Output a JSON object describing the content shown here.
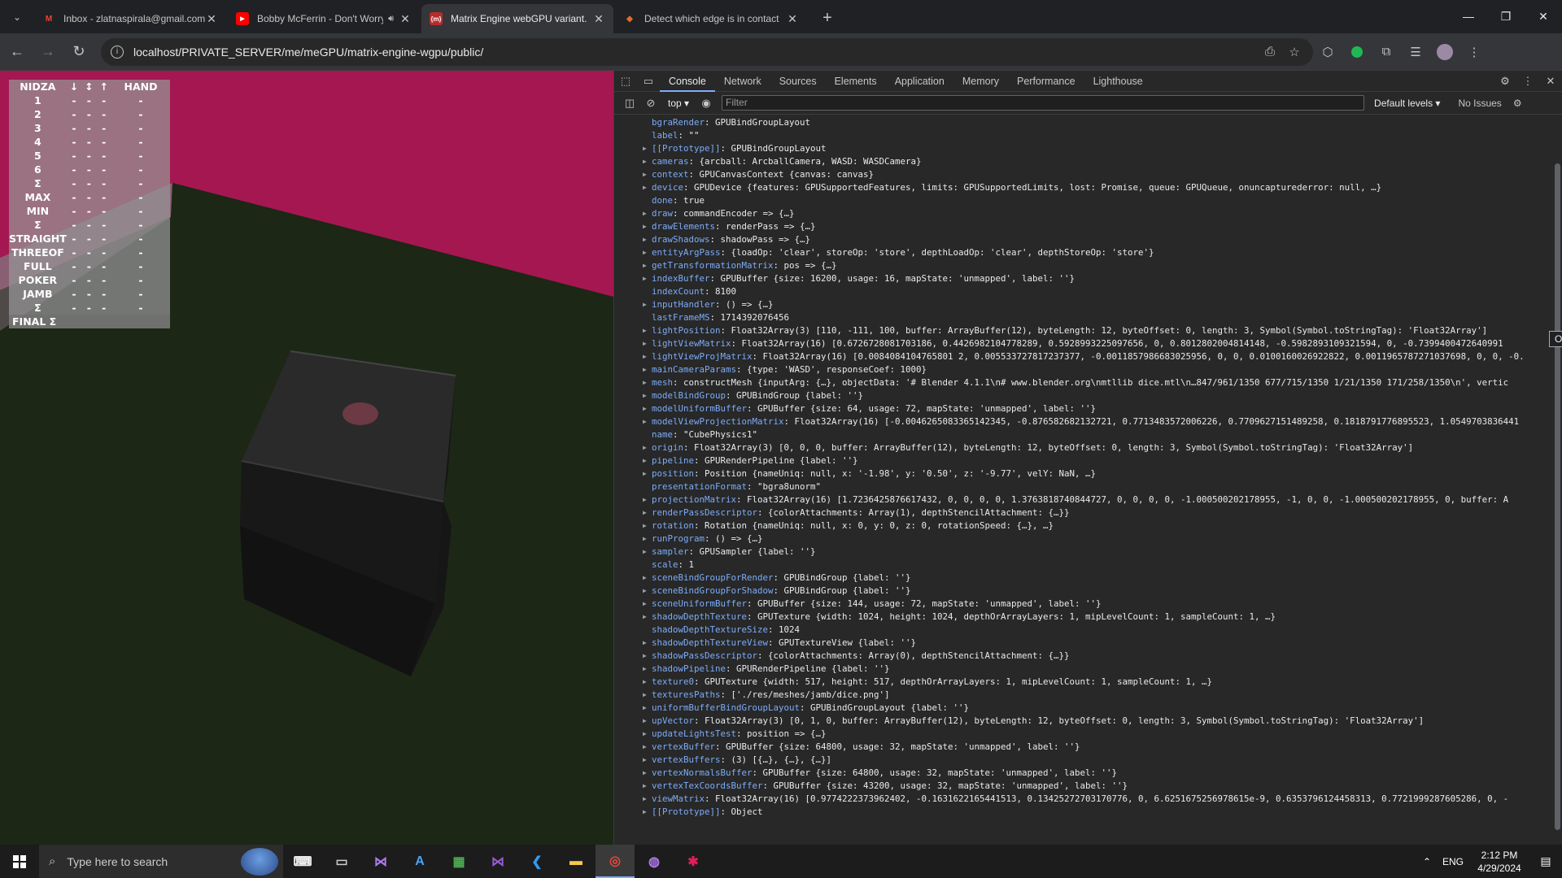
{
  "browser": {
    "tabs": [
      {
        "title": "Inbox - zlatnaspirala@gmail.com",
        "favicon": "gmail-icon",
        "color": "#ea4335",
        "glyph": "M"
      },
      {
        "title": "Bobby McFerrin - Don't Worry",
        "favicon": "youtube-icon",
        "color": "#ff0000",
        "glyph": "▶"
      },
      {
        "title": "Matrix Engine webGPU variant.",
        "favicon": "matrix-engine-icon",
        "color": "#e04040",
        "glyph": "m"
      },
      {
        "title": "Detect which edge is in contact",
        "favicon": "doc-icon",
        "color": "#e26a2c",
        "glyph": "◆"
      }
    ],
    "url": "localhost/PRIVATE_SERVER/me/meGPU/matrix-engine-wgpu/public/"
  },
  "scoreboard": {
    "headers": [
      "NIDZA",
      "↓",
      "↕",
      "↑",
      "HAND"
    ],
    "rows": [
      [
        "1",
        "-",
        "-",
        "-",
        "-"
      ],
      [
        "2",
        "-",
        "-",
        "-",
        "-"
      ],
      [
        "3",
        "-",
        "-",
        "-",
        "-"
      ],
      [
        "4",
        "-",
        "-",
        "-",
        "-"
      ],
      [
        "5",
        "-",
        "-",
        "-",
        "-"
      ],
      [
        "6",
        "-",
        "-",
        "-",
        "-"
      ],
      [
        "Σ",
        "-",
        "-",
        "-",
        "-"
      ],
      [
        "MAX",
        "-",
        "-",
        "-",
        "-"
      ],
      [
        "MIN",
        "-",
        "-",
        "-",
        "-"
      ],
      [
        "Σ",
        "-",
        "-",
        "-",
        "-"
      ],
      [
        "STRAIGHT",
        "-",
        "-",
        "-",
        "-"
      ],
      [
        "THREEOF",
        "-",
        "-",
        "-",
        "-"
      ],
      [
        "FULL",
        "-",
        "-",
        "-",
        "-"
      ],
      [
        "POKER",
        "-",
        "-",
        "-",
        "-"
      ],
      [
        "JAMB",
        "-",
        "-",
        "-",
        "-"
      ],
      [
        "Σ",
        "-",
        "-",
        "-",
        "-"
      ]
    ],
    "final_label": "FINAL Σ"
  },
  "devtools": {
    "tabs": [
      "Console",
      "Network",
      "Sources",
      "Elements",
      "Application",
      "Memory",
      "Performance",
      "Lighthouse"
    ],
    "active_tab": "Console",
    "context": "top ▾",
    "filter_placeholder": "Filter",
    "levels": "Default levels ▾",
    "issues": "No Issues",
    "tooltip": "Object",
    "console_lines": [
      {
        "arrow": false,
        "key": "bgraRender",
        "value": "GPUBindGroupLayout"
      },
      {
        "arrow": false,
        "key": "label",
        "value": "\"\""
      },
      {
        "arrow": true,
        "key": "[[Prototype]]",
        "value": "GPUBindGroupLayout"
      },
      {
        "arrow": true,
        "key": "cameras",
        "value": "{arcball: ArcballCamera, WASD: WASDCamera}"
      },
      {
        "arrow": true,
        "key": "context",
        "value": "GPUCanvasContext {canvas: canvas}"
      },
      {
        "arrow": true,
        "key": "device",
        "value": "GPUDevice {features: GPUSupportedFeatures, limits: GPUSupportedLimits, lost: Promise, queue: GPUQueue, onuncapturederror: null, …}"
      },
      {
        "arrow": false,
        "key": "done",
        "value": "true"
      },
      {
        "arrow": true,
        "key": "draw",
        "value": "commandEncoder => {…}"
      },
      {
        "arrow": true,
        "key": "drawElements",
        "value": "renderPass => {…}"
      },
      {
        "arrow": true,
        "key": "drawShadows",
        "value": "shadowPass => {…}"
      },
      {
        "arrow": true,
        "key": "entityArgPass",
        "value": "{loadOp: 'clear', storeOp: 'store', depthLoadOp: 'clear', depthStoreOp: 'store'}"
      },
      {
        "arrow": true,
        "key": "getTransformationMatrix",
        "value": "pos => {…}"
      },
      {
        "arrow": true,
        "key": "indexBuffer",
        "value": "GPUBuffer {size: 16200, usage: 16, mapState: 'unmapped', label: ''}"
      },
      {
        "arrow": false,
        "key": "indexCount",
        "value": "8100"
      },
      {
        "arrow": true,
        "key": "inputHandler",
        "value": "() => {…}"
      },
      {
        "arrow": false,
        "key": "lastFrameMS",
        "value": "1714392076456"
      },
      {
        "arrow": true,
        "key": "lightPosition",
        "value": "Float32Array(3) [110, -111, 100, buffer: ArrayBuffer(12), byteLength: 12, byteOffset: 0, length: 3, Symbol(Symbol.toStringTag): 'Float32Array']"
      },
      {
        "arrow": true,
        "key": "lightViewMatrix",
        "value": "Float32Array(16) [0.6726728081703186, 0.4426982104778289, 0.5928993225097656, 0, 0.8012802004814148, -0.5982893109321594, 0, -0.7399400472640991"
      },
      {
        "arrow": true,
        "key": "lightViewProjMatrix",
        "value": "Float32Array(16) [0.0084084104765801 2, 0.005533727817237377, -0.0011857986683025956, 0, 0, 0.0100160026922822, 0.0011965787271037698, 0, 0, -0."
      },
      {
        "arrow": true,
        "key": "mainCameraParams",
        "value": "{type: 'WASD', responseCoef: 1000}"
      },
      {
        "arrow": true,
        "key": "mesh",
        "value": "constructMesh {inputArg: {…}, objectData: '# Blender 4.1.1\\n# www.blender.org\\nmtllib dice.mtl\\n…847/961/1350 677/715/1350 1/21/1350 171/258/1350\\n', vertic"
      },
      {
        "arrow": true,
        "key": "modelBindGroup",
        "value": "GPUBindGroup {label: ''}"
      },
      {
        "arrow": true,
        "key": "modelUniformBuffer",
        "value": "GPUBuffer {size: 64, usage: 72, mapState: 'unmapped', label: ''}"
      },
      {
        "arrow": true,
        "key": "modelViewProjectionMatrix",
        "value": "Float32Array(16) [-0.0046265083365142345, -0.876582682132721, 0.7713483572006226, 0.7709627151489258, 0.1818791776895523, 1.0549703836441"
      },
      {
        "arrow": false,
        "key": "name",
        "value": "\"CubePhysics1\""
      },
      {
        "arrow": true,
        "key": "origin",
        "value": "Float32Array(3) [0, 0, 0, buffer: ArrayBuffer(12), byteLength: 12, byteOffset: 0, length: 3, Symbol(Symbol.toStringTag): 'Float32Array']"
      },
      {
        "arrow": true,
        "key": "pipeline",
        "value": "GPURenderPipeline {label: ''}"
      },
      {
        "arrow": true,
        "key": "position",
        "value": "Position {nameUniq: null, x: '-1.98', y: '0.50', z: '-9.77', velY: NaN, …}"
      },
      {
        "arrow": false,
        "key": "presentationFormat",
        "value": "\"bgra8unorm\""
      },
      {
        "arrow": true,
        "key": "projectionMatrix",
        "value": "Float32Array(16) [1.7236425876617432, 0, 0, 0, 0, 1.3763818740844727, 0, 0, 0, 0, -1.000500202178955, -1, 0, 0, -1.000500202178955, 0, buffer: A"
      },
      {
        "arrow": true,
        "key": "renderPassDescriptor",
        "value": "{colorAttachments: Array(1), depthStencilAttachment: {…}}"
      },
      {
        "arrow": true,
        "key": "rotation",
        "value": "Rotation {nameUniq: null, x: 0, y: 0, z: 0, rotationSpeed: {…}, …}"
      },
      {
        "arrow": true,
        "key": "runProgram",
        "value": "() => {…}"
      },
      {
        "arrow": true,
        "key": "sampler",
        "value": "GPUSampler {label: ''}"
      },
      {
        "arrow": false,
        "key": "scale",
        "value": "1"
      },
      {
        "arrow": true,
        "key": "sceneBindGroupForRender",
        "value": "GPUBindGroup {label: ''}"
      },
      {
        "arrow": true,
        "key": "sceneBindGroupForShadow",
        "value": "GPUBindGroup {label: ''}"
      },
      {
        "arrow": true,
        "key": "sceneUniformBuffer",
        "value": "GPUBuffer {size: 144, usage: 72, mapState: 'unmapped', label: ''}"
      },
      {
        "arrow": true,
        "key": "shadowDepthTexture",
        "value": "GPUTexture {width: 1024, height: 1024, depthOrArrayLayers: 1, mipLevelCount: 1, sampleCount: 1, …}"
      },
      {
        "arrow": false,
        "key": "shadowDepthTextureSize",
        "value": "1024"
      },
      {
        "arrow": true,
        "key": "shadowDepthTextureView",
        "value": "GPUTextureView {label: ''}"
      },
      {
        "arrow": true,
        "key": "shadowPassDescriptor",
        "value": "{colorAttachments: Array(0), depthStencilAttachment: {…}}"
      },
      {
        "arrow": true,
        "key": "shadowPipeline",
        "value": "GPURenderPipeline {label: ''}"
      },
      {
        "arrow": true,
        "key": "texture0",
        "value": "GPUTexture {width: 517, height: 517, depthOrArrayLayers: 1, mipLevelCount: 1, sampleCount: 1, …}"
      },
      {
        "arrow": true,
        "key": "texturesPaths",
        "value": "['./res/meshes/jamb/dice.png']"
      },
      {
        "arrow": true,
        "key": "uniformBufferBindGroupLayout",
        "value": "GPUBindGroupLayout {label: ''}"
      },
      {
        "arrow": true,
        "key": "upVector",
        "value": "Float32Array(3) [0, 1, 0, buffer: ArrayBuffer(12), byteLength: 12, byteOffset: 0, length: 3, Symbol(Symbol.toStringTag): 'Float32Array']"
      },
      {
        "arrow": true,
        "key": "updateLightsTest",
        "value": "position => {…}"
      },
      {
        "arrow": true,
        "key": "vertexBuffer",
        "value": "GPUBuffer {size: 64800, usage: 32, mapState: 'unmapped', label: ''}"
      },
      {
        "arrow": true,
        "key": "vertexBuffers",
        "value": "(3) [{…}, {…}, {…}]"
      },
      {
        "arrow": true,
        "key": "vertexNormalsBuffer",
        "value": "GPUBuffer {size: 64800, usage: 32, mapState: 'unmapped', label: ''}"
      },
      {
        "arrow": true,
        "key": "vertexTexCoordsBuffer",
        "value": "GPUBuffer {size: 43200, usage: 32, mapState: 'unmapped', label: ''}"
      },
      {
        "arrow": true,
        "key": "viewMatrix",
        "value": "Float32Array(16) [0.9774222373962402, -0.1631622165441513, 0.13425272703170776, 0, 6.6251675256978615e-9, 0.6353796124458313, 0.7721999287605286, 0, -"
      },
      {
        "arrow": true,
        "key": "[[Prototype]]",
        "value": "Object"
      }
    ]
  },
  "taskbar": {
    "search_placeholder": "Type here to search",
    "lang": "ENG",
    "time": "2:12 PM",
    "date": "4/29/2024"
  }
}
